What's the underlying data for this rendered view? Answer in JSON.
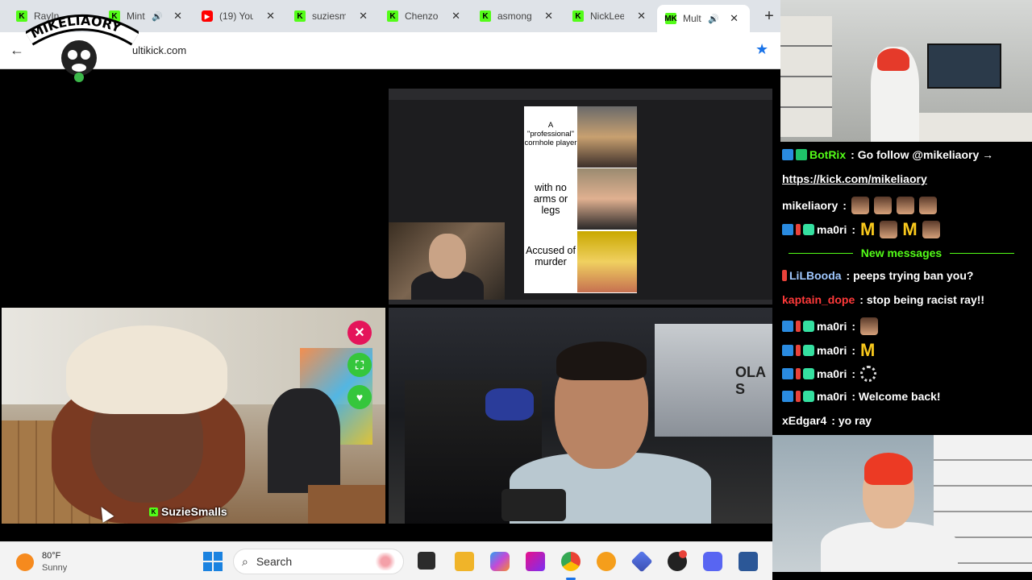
{
  "browser": {
    "tabs": [
      {
        "label": "RayIn",
        "favicon": "kick-icon"
      },
      {
        "label": "Mint",
        "favicon": "kick-icon",
        "audio": true
      },
      {
        "label": "(19) You",
        "favicon": "youtube-icon"
      },
      {
        "label": "suziesm",
        "favicon": "kick-icon"
      },
      {
        "label": "Chenzo",
        "favicon": "kick-icon"
      },
      {
        "label": "asmong",
        "favicon": "kick-icon"
      },
      {
        "label": "NickLee",
        "favicon": "kick-icon"
      },
      {
        "label": "Mult",
        "favicon": "multikick-icon",
        "audio": true,
        "active": true
      }
    ],
    "address": "ultikick.com",
    "overlay_logo": "MIKELIAORY"
  },
  "streams": {
    "asmon": {
      "meme_captions": [
        "A \"professional\" cornhole player",
        "with no arms or legs",
        "Accused of murder"
      ]
    },
    "suzie": {
      "streamer_name": "SuzieSmalls",
      "controls": {
        "close": "✕",
        "fullscreen": "⛶",
        "favorite": "♥"
      }
    },
    "car": {
      "window_text": "OLA S"
    }
  },
  "chat": {
    "messages": [
      {
        "user": "BotRix",
        "user_color": "#53fc18",
        "badges": [
          "blue",
          "green"
        ],
        "text": "Go follow @mikeliaory →"
      },
      {
        "user": "",
        "badges": [],
        "link": "https://kick.com/mikeliaory"
      },
      {
        "user": "mikeliaory",
        "user_color": "#ffffff",
        "badges": [],
        "emotes": [
          "face",
          "face",
          "face",
          "face"
        ]
      },
      {
        "user": "ma0ri",
        "user_color": "#ffffff",
        "badges": [
          "blue",
          "red",
          "sub"
        ],
        "emotes": [
          "mc",
          "face",
          "mc",
          "face"
        ]
      },
      {
        "user": "LiLBooda",
        "user_color": "#a0c8ff",
        "badges": [
          "red"
        ],
        "text": "peeps trying ban you?"
      },
      {
        "user": "kaptain_dope",
        "user_color": "#ff3a3a",
        "badges": [],
        "text": "stop being racist ray!!"
      },
      {
        "user": "ma0ri",
        "user_color": "#ffffff",
        "badges": [
          "blue",
          "red",
          "sub"
        ],
        "emotes": [
          "face"
        ]
      },
      {
        "user": "ma0ri",
        "user_color": "#ffffff",
        "badges": [
          "blue",
          "red",
          "sub"
        ],
        "emotes": [
          "mc"
        ]
      },
      {
        "user": "ma0ri",
        "user_color": "#ffffff",
        "badges": [
          "blue",
          "red",
          "sub"
        ],
        "emotes": [
          "spin"
        ]
      },
      {
        "user": "ma0ri",
        "user_color": "#ffffff",
        "badges": [
          "blue",
          "red",
          "sub"
        ],
        "text": "Welcome back!"
      },
      {
        "user": "xEdgar4",
        "user_color": "#ffffff",
        "badges": [],
        "text": "yo ray"
      }
    ],
    "new_messages_label": "New messages"
  },
  "taskbar": {
    "weather_temp": "80°F",
    "weather_cond": "Sunny",
    "search_placeholder": "Search",
    "apps": [
      "task-view-icon",
      "file-explorer-icon",
      "copilot-icon",
      "premiere-icon",
      "chrome-icon",
      "sun-app-icon",
      "diamond-app-icon",
      "obs-icon",
      "discord-icon",
      "word-icon"
    ],
    "discord_badge": "9+"
  },
  "colors": {
    "kick_green": "#53fc18",
    "accent_blue": "#1a73e8",
    "close_red": "#e4145a"
  }
}
